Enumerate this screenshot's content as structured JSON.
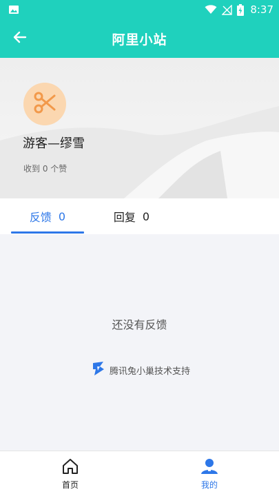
{
  "status_bar": {
    "time": "8:37",
    "icons": [
      "image-icon",
      "wifi-icon",
      "no-signal-icon",
      "battery-charging-icon"
    ]
  },
  "app_bar": {
    "title": "阿里小站",
    "back_icon": "arrow-left-icon"
  },
  "profile": {
    "avatar_icon": "scissors-icon",
    "username": "游客—缪雪",
    "likes_text": "收到 0 个赞"
  },
  "tabs": [
    {
      "label": "反馈",
      "count": "0",
      "active": true
    },
    {
      "label": "回复",
      "count": "0",
      "active": false
    }
  ],
  "empty_state": {
    "message": "还没有反馈"
  },
  "powered_by": {
    "text": "腾讯兔小巢技术支持",
    "icon": "txc-logo-icon"
  },
  "bottom_nav": [
    {
      "label": "首页",
      "icon": "home-icon",
      "active": false
    },
    {
      "label": "我的",
      "icon": "user-icon",
      "active": true
    }
  ],
  "colors": {
    "primary": "#1fd1bd",
    "accent": "#2d77e8",
    "avatar_bg": "#fbd7b0",
    "avatar_fg": "#f2994a"
  }
}
